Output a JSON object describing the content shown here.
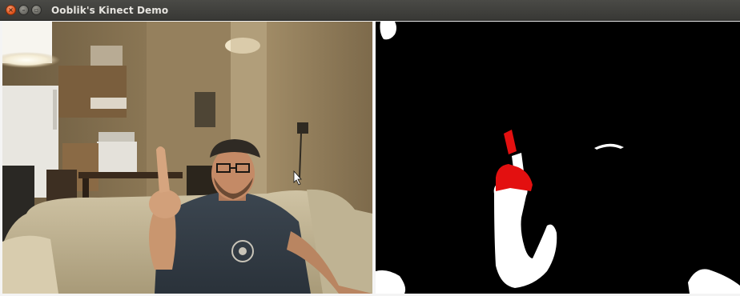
{
  "window": {
    "title": "Ooblik's Kinect Demo",
    "controls": {
      "close_icon": "close-icon",
      "minimize_icon": "minimize-icon",
      "maximize_icon": "maximize-icon"
    }
  },
  "panels": {
    "rgb_view": "camera-feed",
    "depth_view": "depth-mask"
  },
  "colors": {
    "titlebar": "#3f3f3c",
    "close_button": "#e0561f",
    "fingertip_highlight": "#e31010",
    "depth_foreground": "#ffffff",
    "depth_background": "#000000"
  }
}
